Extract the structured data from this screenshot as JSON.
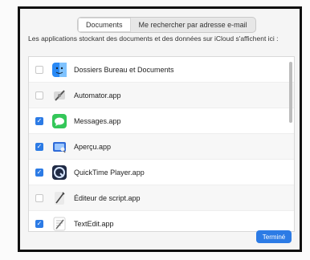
{
  "tabs": {
    "documents": "Documents",
    "email": "Me rechercher par adresse e-mail"
  },
  "description": "Les applications stockant des documents et des données sur iCloud s'affichent ici :",
  "apps": [
    {
      "name": "Dossiers Bureau et Documents",
      "checked": false,
      "icon": "finder-icon"
    },
    {
      "name": "Automator.app",
      "checked": false,
      "icon": "automator-icon"
    },
    {
      "name": "Messages.app",
      "checked": true,
      "icon": "messages-icon"
    },
    {
      "name": "Aperçu.app",
      "checked": true,
      "icon": "preview-icon"
    },
    {
      "name": "QuickTime Player.app",
      "checked": true,
      "icon": "quicktime-icon"
    },
    {
      "name": "Éditeur de script.app",
      "checked": false,
      "icon": "script-editor-icon"
    },
    {
      "name": "TextEdit.app",
      "checked": true,
      "icon": "textedit-icon"
    },
    {
      "name": "",
      "checked": false,
      "icon": "generic-app-icon"
    }
  ],
  "done_button": "Terminé"
}
